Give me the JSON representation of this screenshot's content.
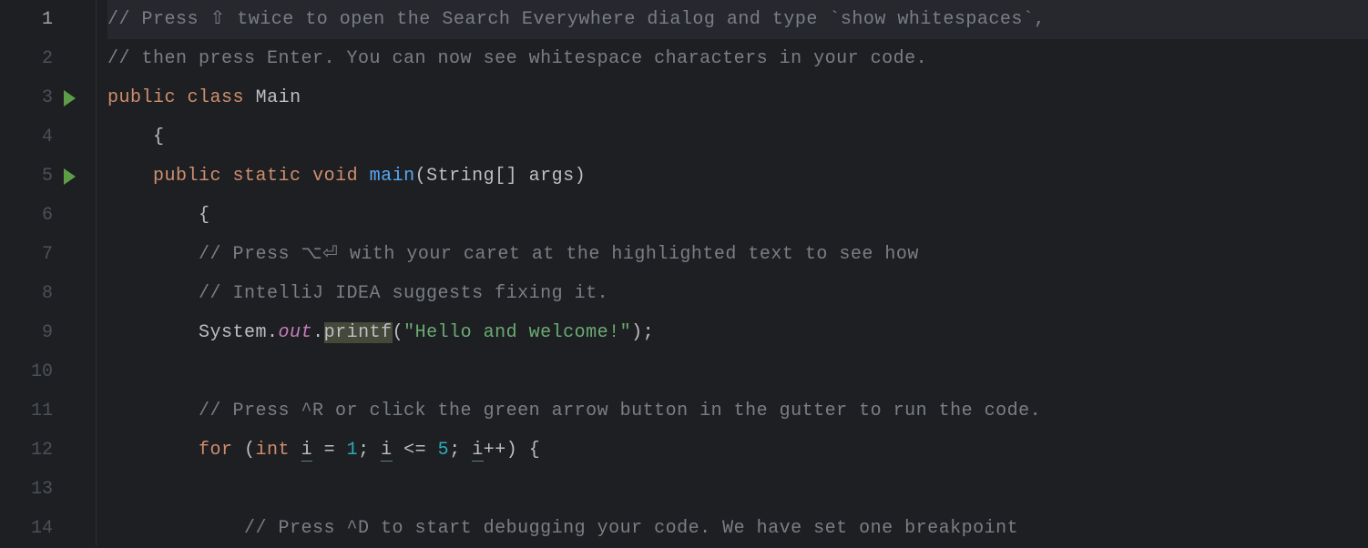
{
  "lines": [
    {
      "num": "1",
      "active": true
    },
    {
      "num": "2"
    },
    {
      "num": "3",
      "run": true
    },
    {
      "num": "4"
    },
    {
      "num": "5",
      "run": true
    },
    {
      "num": "6"
    },
    {
      "num": "7"
    },
    {
      "num": "8"
    },
    {
      "num": "9"
    },
    {
      "num": "10"
    },
    {
      "num": "11"
    },
    {
      "num": "12"
    },
    {
      "num": "13"
    },
    {
      "num": "14"
    }
  ],
  "code": {
    "l1_comment": "// Press ⇧ twice to open the Search Everywhere dialog and type `show whitespaces`,",
    "l2_comment": "// then press Enter. You can now see whitespace characters in your code.",
    "l3_public": "public",
    "l3_class": "class",
    "l3_name": "Main",
    "l4_brace": "{",
    "l5_public": "public",
    "l5_static": "static",
    "l5_void": "void",
    "l5_main": "main",
    "l5_paren_open": "(",
    "l5_string": "String",
    "l5_brackets": "[]",
    "l5_args": " args",
    "l5_paren_close": ")",
    "l6_brace": "{",
    "l7_comment": "// Press ⌥⏎ with your caret at the highlighted text to see how",
    "l8_comment": "// IntelliJ IDEA suggests fixing it.",
    "l9_system": "System",
    "l9_dot1": ".",
    "l9_out": "out",
    "l9_dot2": ".",
    "l9_printf": "printf",
    "l9_paren_open": "(",
    "l9_string": "\"Hello and welcome!\"",
    "l9_close": ");",
    "l11_comment": "// Press ^R or click the green arrow button in the gutter to run the code.",
    "l12_for": "for",
    "l12_paren": " (",
    "l12_int": "int",
    "l12_space1": " ",
    "l12_i1": "i",
    "l12_eq": " = ",
    "l12_one": "1",
    "l12_semi1": "; ",
    "l12_i2": "i",
    "l12_lte": " <= ",
    "l12_five": "5",
    "l12_semi2": "; ",
    "l12_i3": "i",
    "l12_inc": "++) {",
    "l14_comment": "// Press ^D to start debugging your code. We have set one breakpoint"
  },
  "indent": {
    "i1": "    ",
    "i2": "        ",
    "i3": "            "
  }
}
